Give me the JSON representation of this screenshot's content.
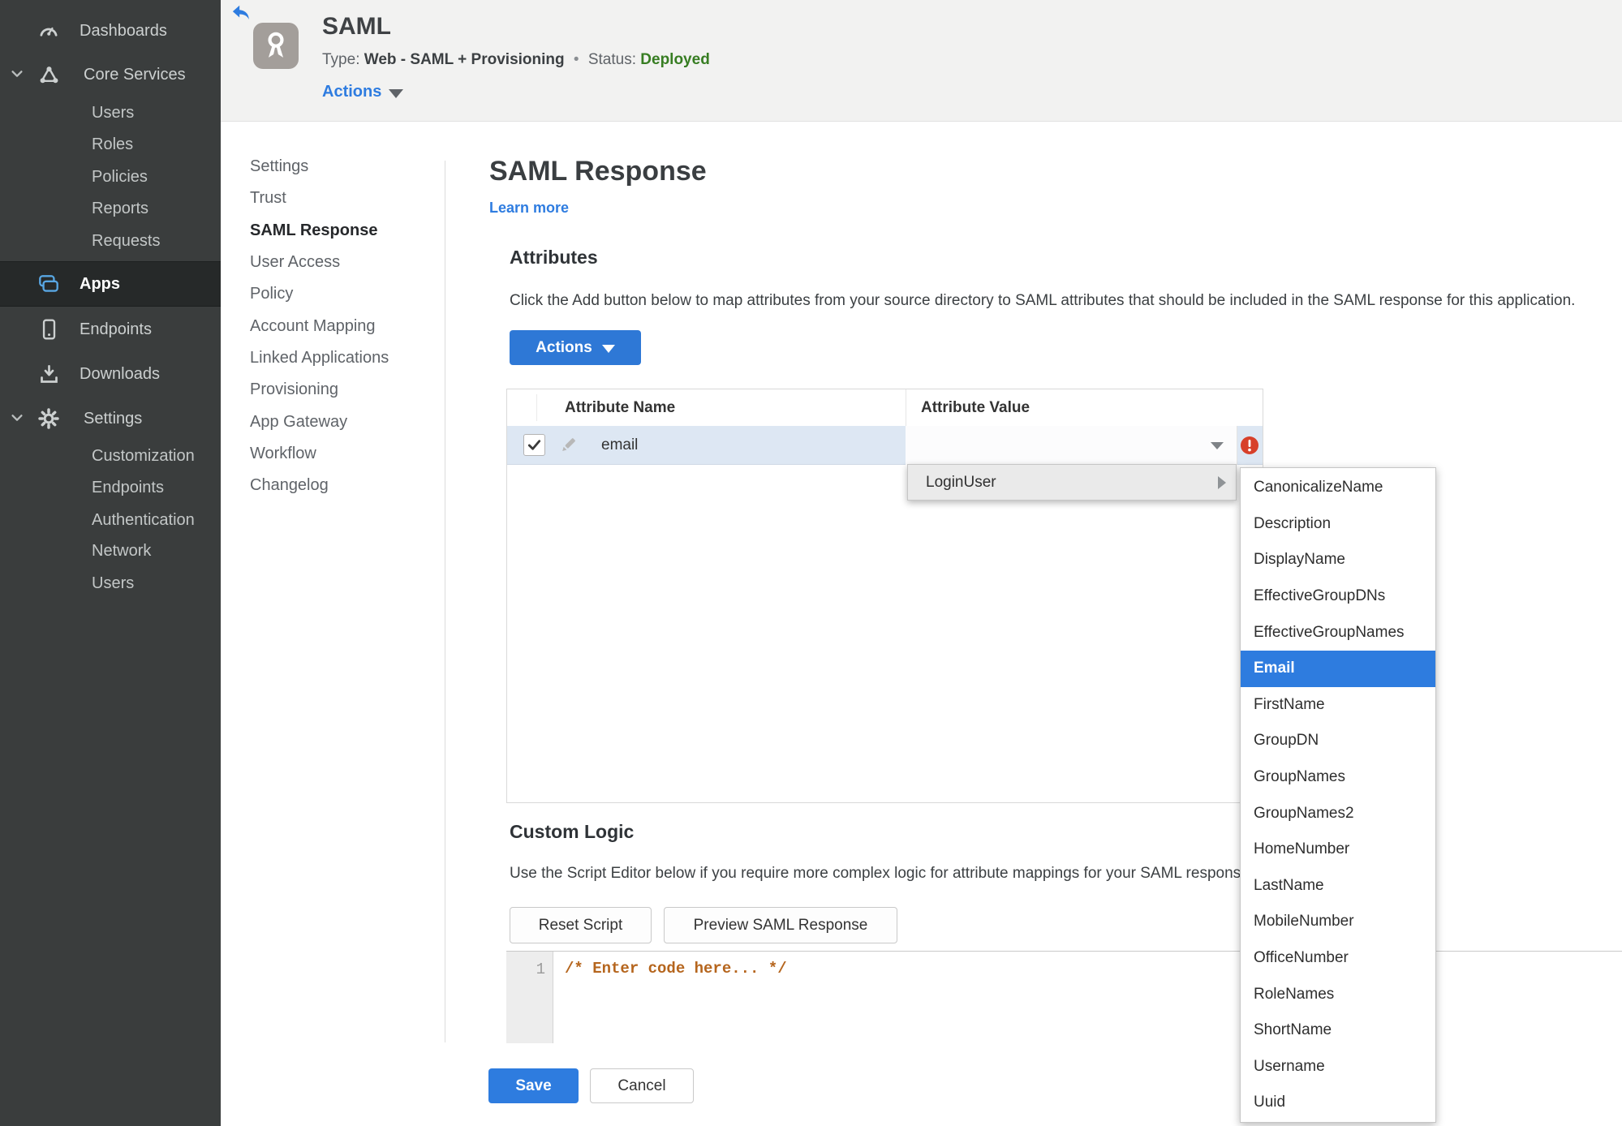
{
  "colors": {
    "accent_blue": "#2e7cdf",
    "status_green": "#377d22",
    "error_red": "#d7402a",
    "code_comment_orange": "#b5651d",
    "sidebar_bg": "#3a3d3d",
    "apps_icon_blue": "#58a6e2",
    "row_selected_blue": "#dde7f3"
  },
  "sidebar": {
    "items": [
      {
        "label": "Dashboards",
        "icon": "gauge-icon"
      },
      {
        "label": "Core Services",
        "icon": "core-services-icon",
        "expanded": true
      },
      {
        "label": "Users"
      },
      {
        "label": "Roles"
      },
      {
        "label": "Policies"
      },
      {
        "label": "Reports"
      },
      {
        "label": "Requests"
      },
      {
        "label": "Apps",
        "icon": "apps-icon",
        "selected": true
      },
      {
        "label": "Endpoints",
        "icon": "phone-icon"
      },
      {
        "label": "Downloads",
        "icon": "download-icon"
      },
      {
        "label": "Settings",
        "icon": "gear-icon",
        "expanded": true
      },
      {
        "label": "Customization"
      },
      {
        "label": "Endpoints"
      },
      {
        "label": "Authentication"
      },
      {
        "label": "Network"
      },
      {
        "label": "Users"
      }
    ]
  },
  "header": {
    "back_icon": "back-arrow-icon",
    "app_icon": "award-badge-icon",
    "title": "SAML",
    "type_label": "Type:",
    "type_value": "Web - SAML + Provisioning",
    "separator": "•",
    "status_label": "Status:",
    "status_value": "Deployed",
    "actions_label": "Actions"
  },
  "subnav": {
    "active": "SAML Response",
    "items": [
      {
        "label": "Settings"
      },
      {
        "label": "Trust"
      },
      {
        "label": "SAML Response"
      },
      {
        "label": "User Access"
      },
      {
        "label": "Policy"
      },
      {
        "label": "Account Mapping"
      },
      {
        "label": "Linked Applications"
      },
      {
        "label": "Provisioning"
      },
      {
        "label": "App Gateway"
      },
      {
        "label": "Workflow"
      },
      {
        "label": "Changelog"
      }
    ]
  },
  "main": {
    "page_title": "SAML Response",
    "learn_more": "Learn more",
    "attributes": {
      "heading": "Attributes",
      "description": "Click the Add button below to map attributes from your source directory to SAML attributes that should be included in the SAML response for this application.",
      "actions_button": "Actions",
      "table": {
        "columns": [
          "Attribute Name",
          "Attribute Value"
        ],
        "rows": [
          {
            "name": "email",
            "value": "",
            "checked": true,
            "has_error": true
          }
        ]
      }
    },
    "value_menu": {
      "parent_item": "LoginUser",
      "submenu": {
        "selected": "Email",
        "items": [
          "CanonicalizeName",
          "Description",
          "DisplayName",
          "EffectiveGroupDNs",
          "EffectiveGroupNames",
          "Email",
          "FirstName",
          "GroupDN",
          "GroupNames",
          "GroupNames2",
          "HomeNumber",
          "LastName",
          "MobileNumber",
          "OfficeNumber",
          "RoleNames",
          "ShortName",
          "Username",
          "Uuid"
        ]
      }
    },
    "custom_logic": {
      "heading": "Custom Logic",
      "description": "Use the Script Editor below if you require more complex logic for attribute mappings for your SAML response.",
      "reset_button": "Reset Script",
      "preview_button": "Preview SAML Response",
      "editor": {
        "line_number": "1",
        "code": "/* Enter code here... */"
      }
    },
    "footer": {
      "save_button": "Save",
      "cancel_button": "Cancel"
    }
  }
}
